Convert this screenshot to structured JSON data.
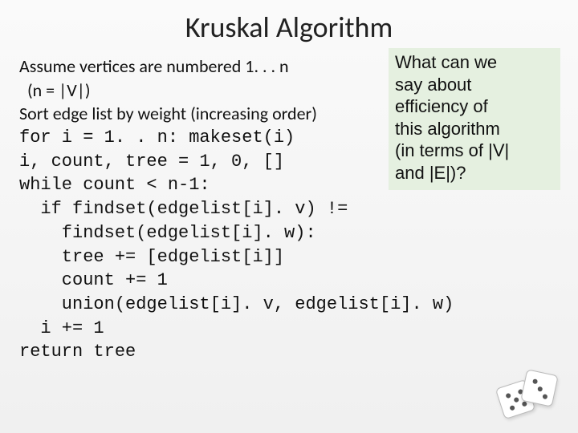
{
  "title": "Kruskal Algorithm",
  "lines": {
    "l1": "Assume vertices are numbered 1. . . n",
    "l2": "  (n = |V|)",
    "l3": "Sort edge list by weight (increasing order)",
    "l4": "for i = 1. . n: makeset(i)",
    "l5": "i, count, tree = 1, 0, []",
    "l6": "",
    "l7": "while count < n-1:",
    "l8": "  if findset(edgelist[i]. v) !=",
    "l9": "    findset(edgelist[i]. w):",
    "l10": "    tree += [edgelist[i]]",
    "l11": "    count += 1",
    "l12": "    union(edgelist[i]. v, edgelist[i]. w)",
    "l13": "  i += 1",
    "l14": "return tree"
  },
  "callout": {
    "l1": "What can we",
    "l2": "say about",
    "l3": "efficiency of",
    "l4": "this algorithm",
    "l5": "(in terms of |V|",
    "l6": "and |E|)?"
  }
}
